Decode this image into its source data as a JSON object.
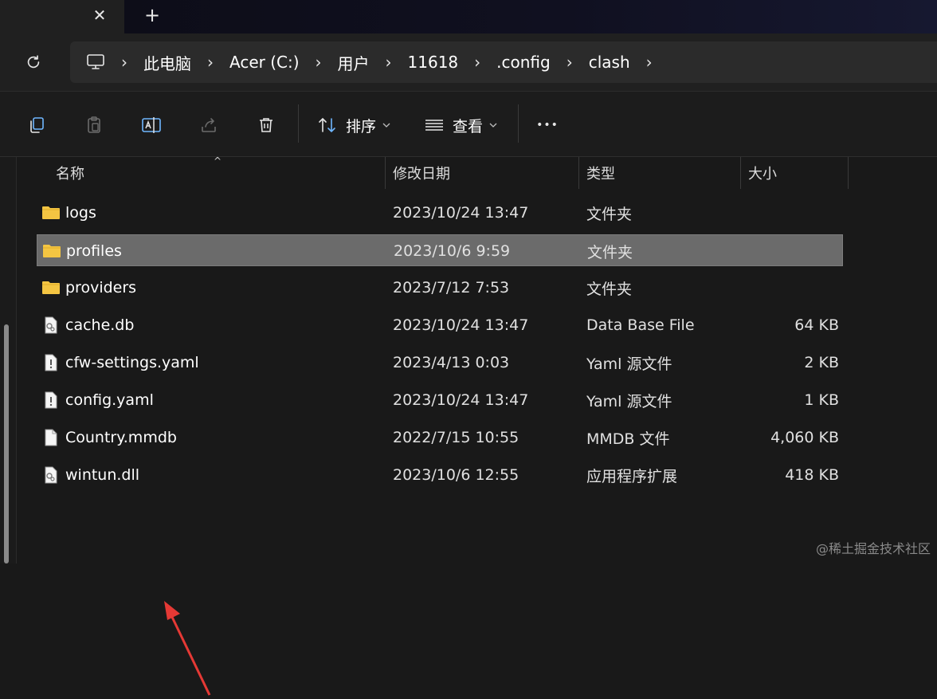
{
  "tab": {
    "close_glyph": "✕",
    "new_glyph": "+"
  },
  "breadcrumb": {
    "items": [
      "此电脑",
      "Acer (C:)",
      "用户",
      "11618",
      ".config",
      "clash"
    ],
    "separator": "›"
  },
  "toolbar": {
    "sort_label": "排序",
    "view_label": "查看",
    "more_label": "•••"
  },
  "columns": {
    "name": "名称",
    "modified": "修改日期",
    "type": "类型",
    "size": "大小"
  },
  "files": [
    {
      "name": "logs",
      "modified": "2023/10/24 13:47",
      "type": "文件夹",
      "size": "",
      "icon": "folder-icon",
      "selected": false
    },
    {
      "name": "profiles",
      "modified": "2023/10/6 9:59",
      "type": "文件夹",
      "size": "",
      "icon": "folder-icon",
      "selected": true
    },
    {
      "name": "providers",
      "modified": "2023/7/12 7:53",
      "type": "文件夹",
      "size": "",
      "icon": "folder-icon",
      "selected": false
    },
    {
      "name": "cache.db",
      "modified": "2023/10/24 13:47",
      "type": "Data Base File",
      "size": "64 KB",
      "icon": "system-file-icon",
      "selected": false
    },
    {
      "name": "cfw-settings.yaml",
      "modified": "2023/4/13 0:03",
      "type": "Yaml 源文件",
      "size": "2 KB",
      "icon": "yaml-file-icon",
      "selected": false
    },
    {
      "name": "config.yaml",
      "modified": "2023/10/24 13:47",
      "type": "Yaml 源文件",
      "size": "1 KB",
      "icon": "yaml-file-icon",
      "selected": false
    },
    {
      "name": "Country.mmdb",
      "modified": "2022/7/15 10:55",
      "type": "MMDB 文件",
      "size": "4,060 KB",
      "icon": "blank-file-icon",
      "selected": false
    },
    {
      "name": "wintun.dll",
      "modified": "2023/10/6 12:55",
      "type": "应用程序扩展",
      "size": "418 KB",
      "icon": "system-file-icon",
      "selected": false
    }
  ],
  "watermark": "@稀土掘金技术社区",
  "colors": {
    "selected_row": "#6b6b6b",
    "folder": "#f4c542",
    "annotation_arrow": "#e53935"
  }
}
